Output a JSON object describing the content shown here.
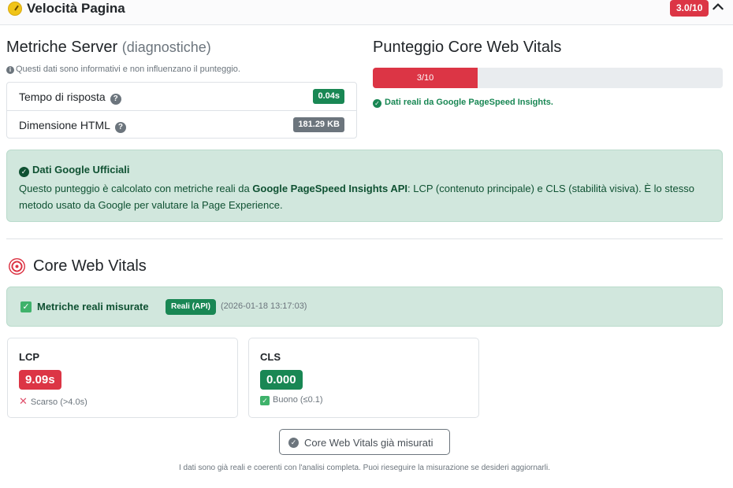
{
  "header": {
    "title": "Velocità Pagina",
    "score_badge": "3.0/10",
    "icons": [
      "speed-gauge-icon",
      "chevron-up-icon"
    ]
  },
  "server_metrics": {
    "title": "Metriche Server",
    "title_suffix": "(diagnostiche)",
    "note": "Questi dati sono informativi e non influenzano il punteggio.",
    "rows": [
      {
        "label": "Tempo di risposta",
        "value": "0.04s",
        "status_color": "#198754"
      },
      {
        "label": "Dimensione HTML",
        "value": "181.29 KB",
        "status_color": "#6c757d"
      }
    ]
  },
  "cwv_score": {
    "title": "Punteggio Core Web Vitals",
    "progress_label": "3/10",
    "progress_value": 0.3,
    "note": "Dati reali da Google PageSpeed Insights."
  },
  "google_box": {
    "title": "Dati Google Ufficiali",
    "text_before": "Questo punteggio è calcolato con metriche reali da ",
    "text_bold": "Google PageSpeed Insights API",
    "text_after": ": LCP (contenuto principale) e CLS (stabilità visiva). È lo stesso metodo usato da Google per valutare la Page Experience."
  },
  "core_web_vitals": {
    "title": "Core Web Vitals",
    "measured_label": "Metriche reali misurate",
    "api_badge": "Reali (API)",
    "timestamp": "(2026-01-18 13:17:03)",
    "cards": [
      {
        "name": "LCP",
        "value": "9.09s",
        "status": "Scarso (>4.0s)",
        "color": "#dc3545"
      },
      {
        "name": "CLS",
        "value": "0.000",
        "status": "Buono (≤0.1)",
        "color": "#198754"
      }
    ],
    "button_label": "Core Web Vitals già misurati",
    "footnote": "I dati sono già reali e coerenti con l'analisi completa. Puoi rieseguire la misurazione se desideri aggiornarli."
  },
  "colors": {
    "danger": "#dc3545",
    "success": "#198754",
    "success_bg": "#d1e7dd",
    "secondary": "#6c757d"
  }
}
